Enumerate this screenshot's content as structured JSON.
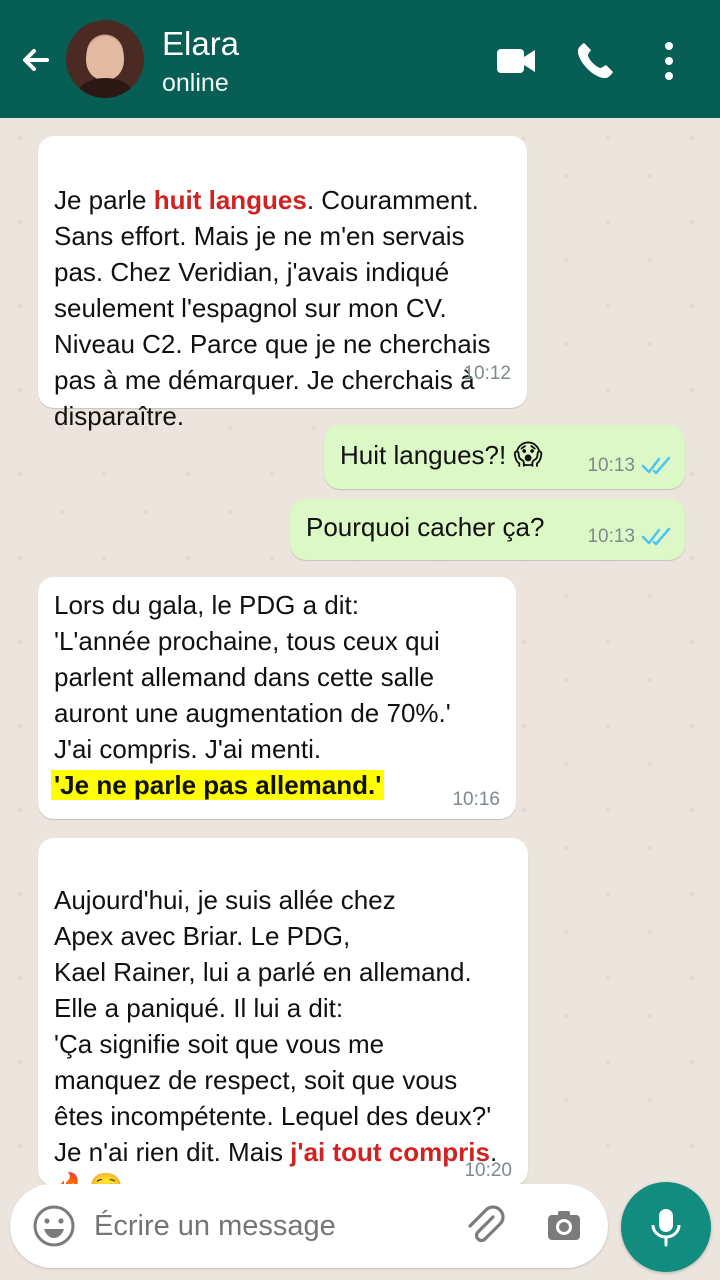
{
  "header": {
    "contact_name": "Elara",
    "status": "online"
  },
  "composer": {
    "placeholder": "Écrire un message"
  },
  "messages": [
    {
      "direction": "incoming",
      "time": "10:12",
      "text_before": "Je parle ",
      "highlight": "huit langues",
      "text_after": ". Couramment.\nSans effort. Mais je ne m'en servais\npas. Chez Veridian, j'avais indiqué\nseulement l'espagnol sur mon CV.\nNiveau C2. Parce que je ne cherchais\npas à me démarquer. Je cherchais à\ndisparaître."
    },
    {
      "direction": "outgoing",
      "time": "10:13",
      "text": "Huit langues?! ",
      "emoji": "😱",
      "status": "read"
    },
    {
      "direction": "outgoing",
      "time": "10:13",
      "text": "Pourquoi cacher ça?",
      "status": "read"
    },
    {
      "direction": "incoming",
      "time": "10:16",
      "text": "Lors du gala, le PDG a dit:\n'L'année prochaine, tous ceux qui\nparlent allemand dans cette salle\nauront une augmentation de 70%.'\nJ'ai compris. J'ai menti.",
      "highlight": "'Je ne parle pas allemand.'"
    },
    {
      "direction": "incoming",
      "time": "10:20",
      "text_before": "Aujourd'hui, je suis allée chez\nApex avec Briar. Le PDG,\nKael Rainer, lui a parlé en allemand.\nElle a paniqué. Il lui a dit:\n'Ça signifie soit que vous me\nmanquez de respect, soit que vous\nêtes incompétente. Lequel des deux?'\nJe n'ai rien dit. Mais ",
      "highlight": "j'ai tout compris",
      "text_after": ".",
      "emoji": "🔥☺️"
    }
  ],
  "icons": {
    "back": "arrow-left-icon",
    "video": "video-camera-icon",
    "call": "phone-icon",
    "menu": "more-vertical-icon",
    "emoji": "emoji-icon",
    "attach": "paperclip-icon",
    "camera": "camera-icon",
    "mic": "microphone-icon",
    "read": "double-check-icon"
  },
  "colors": {
    "header": "#075e54",
    "chat_background": "#ece5dd",
    "incoming_bubble": "#ffffff",
    "outgoing_bubble": "#dcf8c6",
    "read_check": "#4fc3f7",
    "mic_button": "#128c7e",
    "accent_red": "#d12222",
    "highlight": "#ffff00"
  }
}
